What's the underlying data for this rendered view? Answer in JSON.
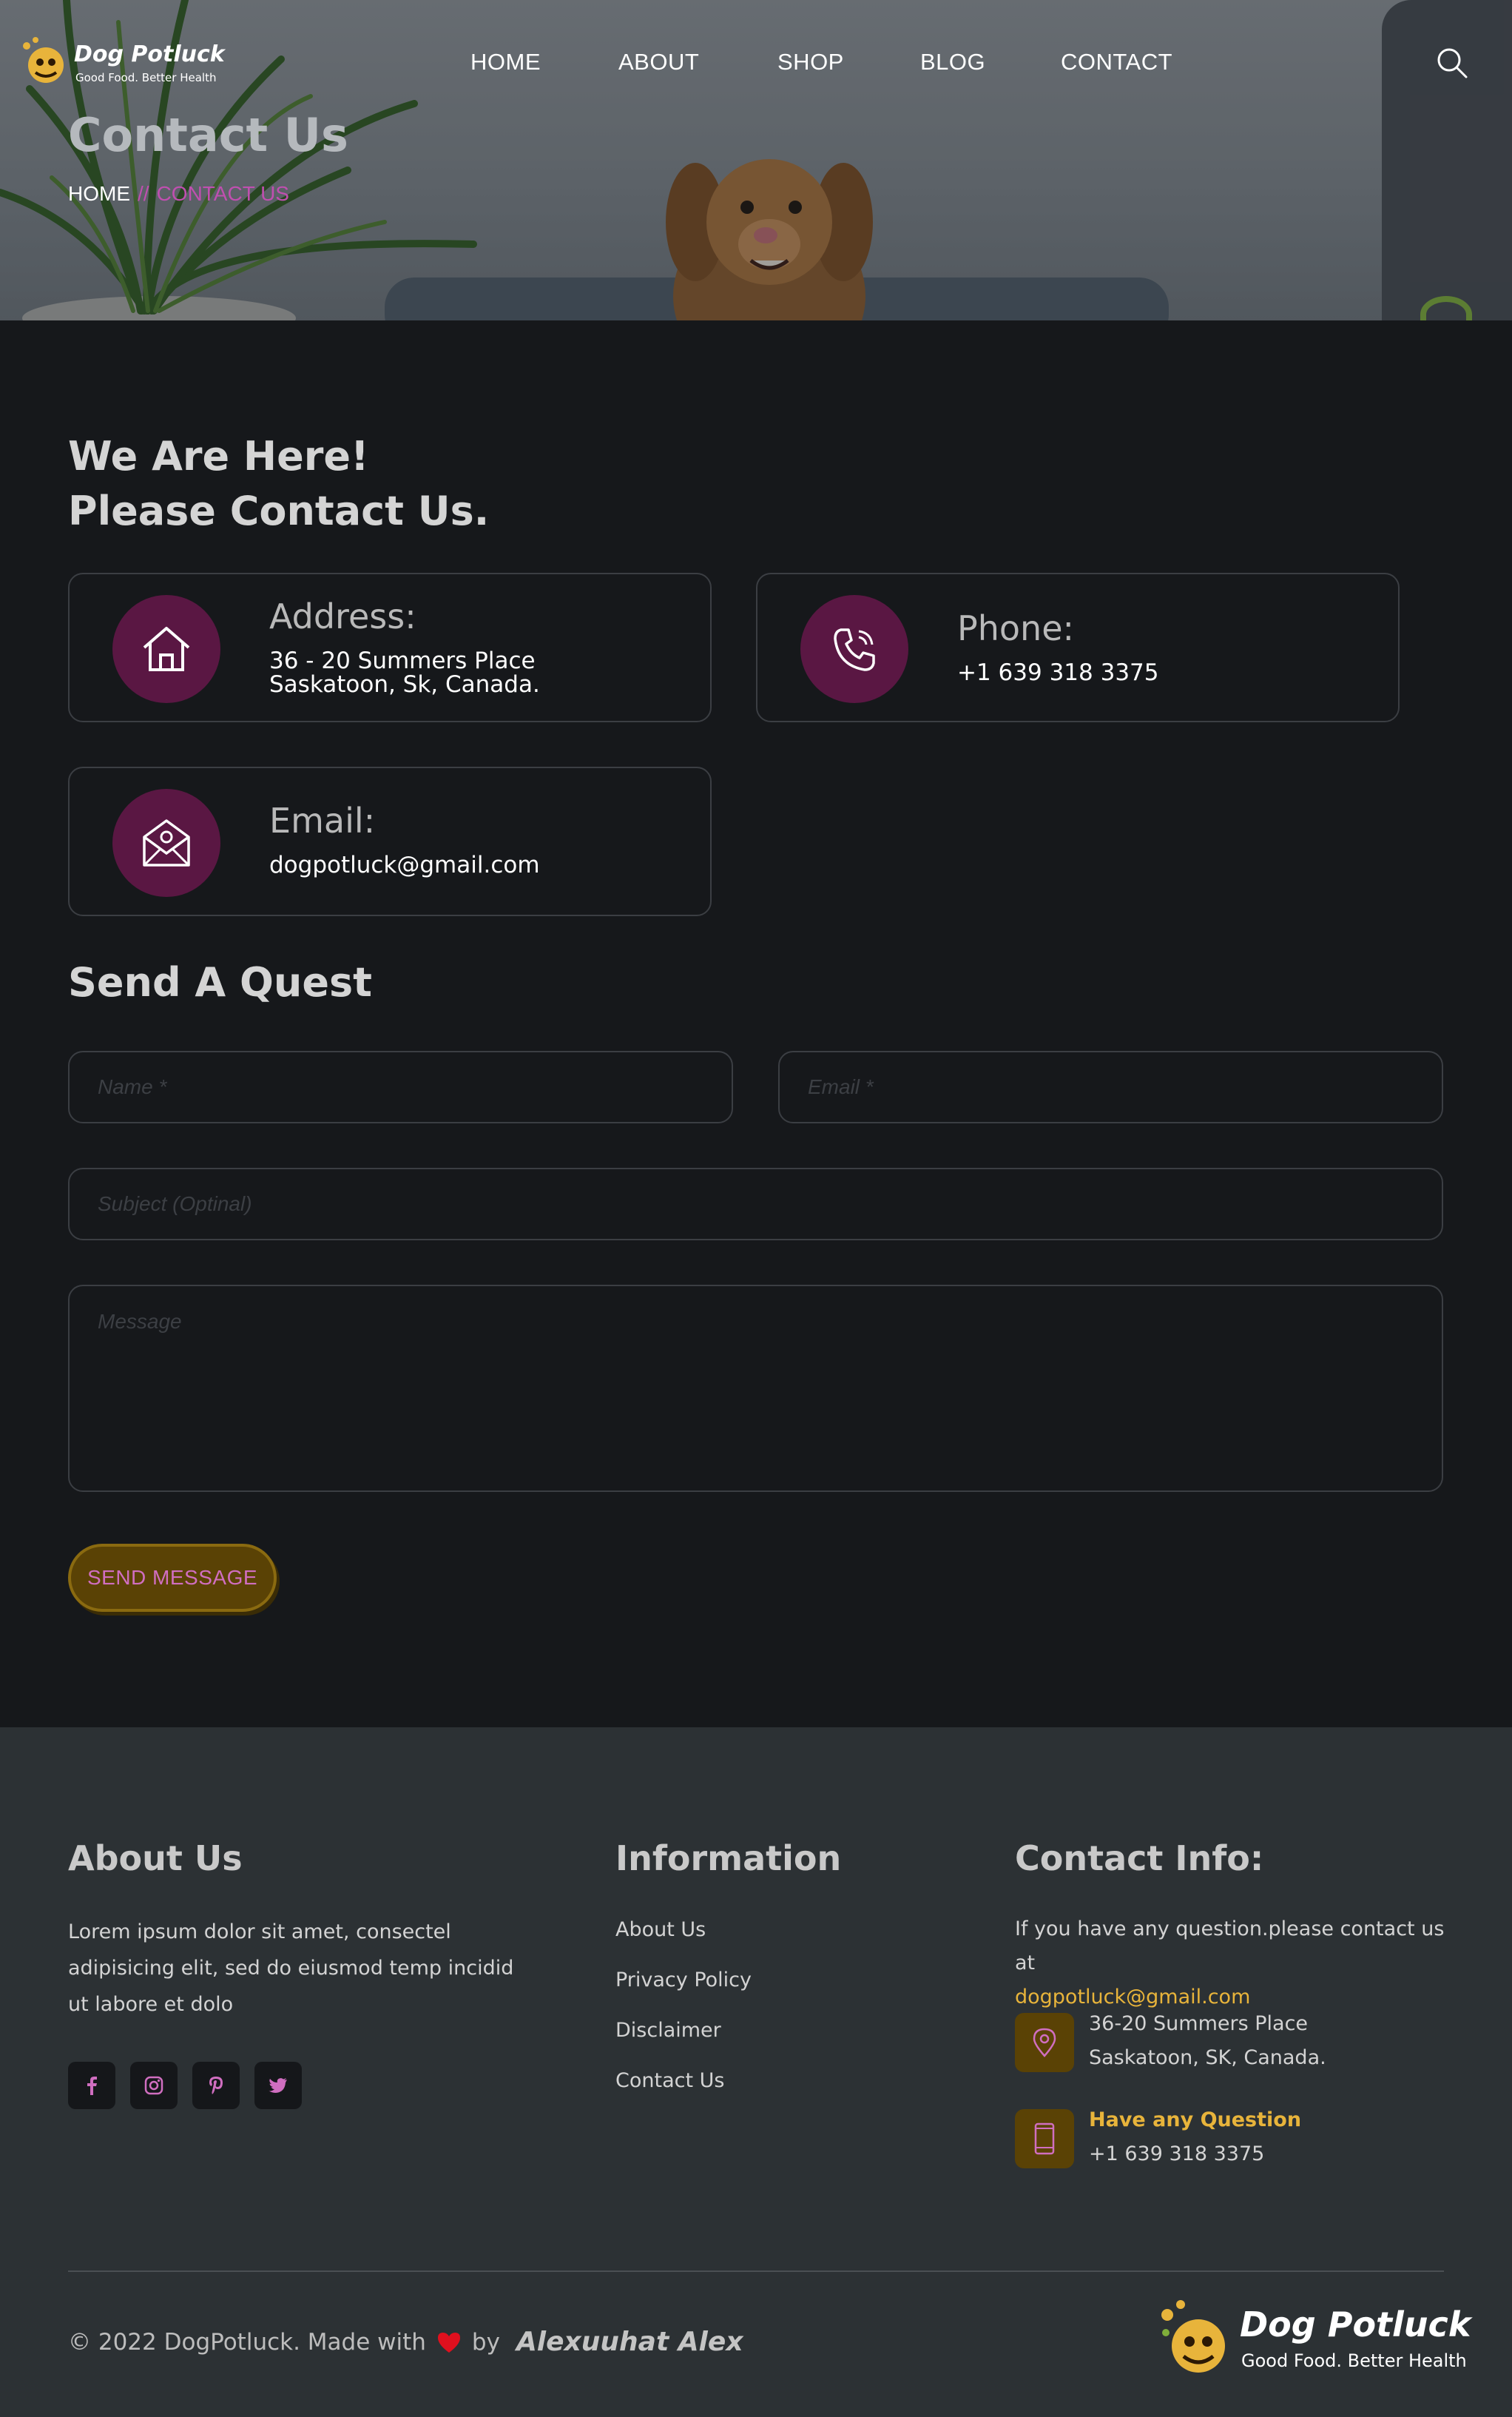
{
  "brand": {
    "name": "Dog Potluck",
    "tagline": "Good Food. Better Health"
  },
  "nav": {
    "items": [
      "HOME",
      "ABOUT",
      "SHOP",
      "BLOG",
      "CONTACT"
    ]
  },
  "hero": {
    "title": "Contact Us",
    "breadcrumb_home": "HOME",
    "breadcrumb_sep": "//",
    "breadcrumb_current": "CONTACT US"
  },
  "contact": {
    "heading_line1": "We Are Here!",
    "heading_line2": "Please Contact Us.",
    "address": {
      "title": "Address:",
      "line1": "36 - 20 Summers Place",
      "line2": "Saskatoon, Sk, Canada."
    },
    "phone": {
      "title": "Phone:",
      "value": "+1 639 318 3375"
    },
    "email": {
      "title": "Email:",
      "value": "dogpotluck@gmail.com"
    }
  },
  "form": {
    "heading": "Send A Quest",
    "name_placeholder": "Name *",
    "email_placeholder": "Email *",
    "subject_placeholder": "Subject (Optinal)",
    "message_placeholder": "Message",
    "submit_label": "SEND MESSAGE"
  },
  "footer": {
    "about": {
      "heading": "About Us",
      "text": "Lorem ipsum dolor sit amet, consectel adipisicing elit, sed do eiusmod temp incidid ut labore et dolo"
    },
    "social": [
      "facebook-icon",
      "instagram-icon",
      "pinterest-icon",
      "twitter-icon"
    ],
    "information": {
      "heading": "Information",
      "links": [
        "About Us",
        "Privacy Policy",
        "Disclaimer",
        "Contact Us"
      ]
    },
    "contact_info": {
      "heading": "Contact Info:",
      "intro": "If you have any question.please contact us at",
      "email": "dogpotluck@gmail.com",
      "address_line1": "36-20 Summers Place",
      "address_line2": "Saskatoon, SK, Canada.",
      "question_label": "Have any Question",
      "phone": "+1 639 318 3375"
    },
    "copyright_prefix": "© 2022 DogPotluck. Made with",
    "copyright_by": "by",
    "author": "Alexuuhat Alex"
  },
  "colors": {
    "accent_purple": "#5a1743",
    "accent_gold": "#e8b43b",
    "accent_pink": "#c04fb0",
    "bg": "#16181b",
    "footer_bg": "#2c3134"
  }
}
